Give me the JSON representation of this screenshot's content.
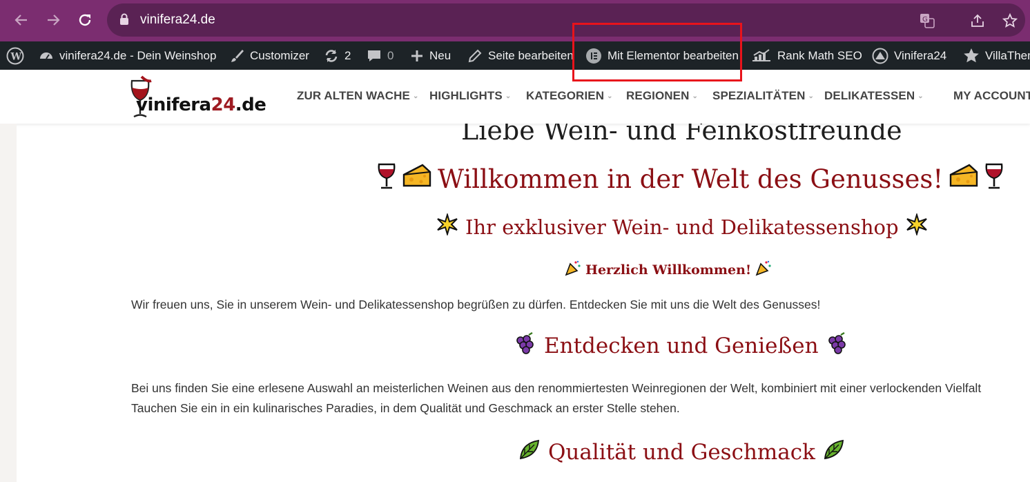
{
  "browser": {
    "url": "vinifera24.de",
    "theme_color": "#7b2d70"
  },
  "adminbar": {
    "site_name": "vinifera24.de - Dein Weinshop",
    "customizer": "Customizer",
    "updates_count": "2",
    "comments_count": "0",
    "new": "Neu",
    "edit_page": "Seite bearbeiten",
    "elementor_edit": "Mit Elementor bearbeiten",
    "rank_math": "Rank Math SEO",
    "vinifera24": "Vinifera24",
    "villatheme": "VillaThem"
  },
  "site": {
    "logo_main": "vinifera",
    "logo_number": "24",
    "logo_tld": ".de",
    "menu": [
      "ZUR ALTEN WACHE",
      "HIGHLIGHTS",
      "KATEGORIEN",
      "REGIONEN",
      "SPEZIALITÄTEN",
      "DELIKATESSEN",
      "MY ACCOUNT"
    ]
  },
  "content": {
    "heading_top": "Liebe Wein- und Feinkostfreunde",
    "welcome": "Willkommen in der Welt des Genusses!",
    "shop_title": "Ihr exklusiver Wein- und Delikatessenshop",
    "greeting": "Herzlich Willkommen!",
    "intro": "Wir freuen uns, Sie in unserem Wein- und Delikatessenshop begrüßen zu dürfen. Entdecken Sie mit uns die Welt des Genusses!",
    "discover_title": "Entdecken und Genießen",
    "discover_p1": "Bei uns finden Sie eine erlesene Auswahl an meisterlichen Weinen aus den renommiertesten Weinregionen der Welt, kombiniert mit einer verlockenden Vielfalt",
    "discover_p2": "Tauchen Sie ein in ein kulinarisches Paradies, in dem Qualität und Geschmack an erster Stelle stehen.",
    "quality_title": "Qualität und Geschmack"
  },
  "colors": {
    "accent_red": "#8b0f14",
    "highlight_box": "#e8131b",
    "adminbar_bg": "#1d2327"
  }
}
